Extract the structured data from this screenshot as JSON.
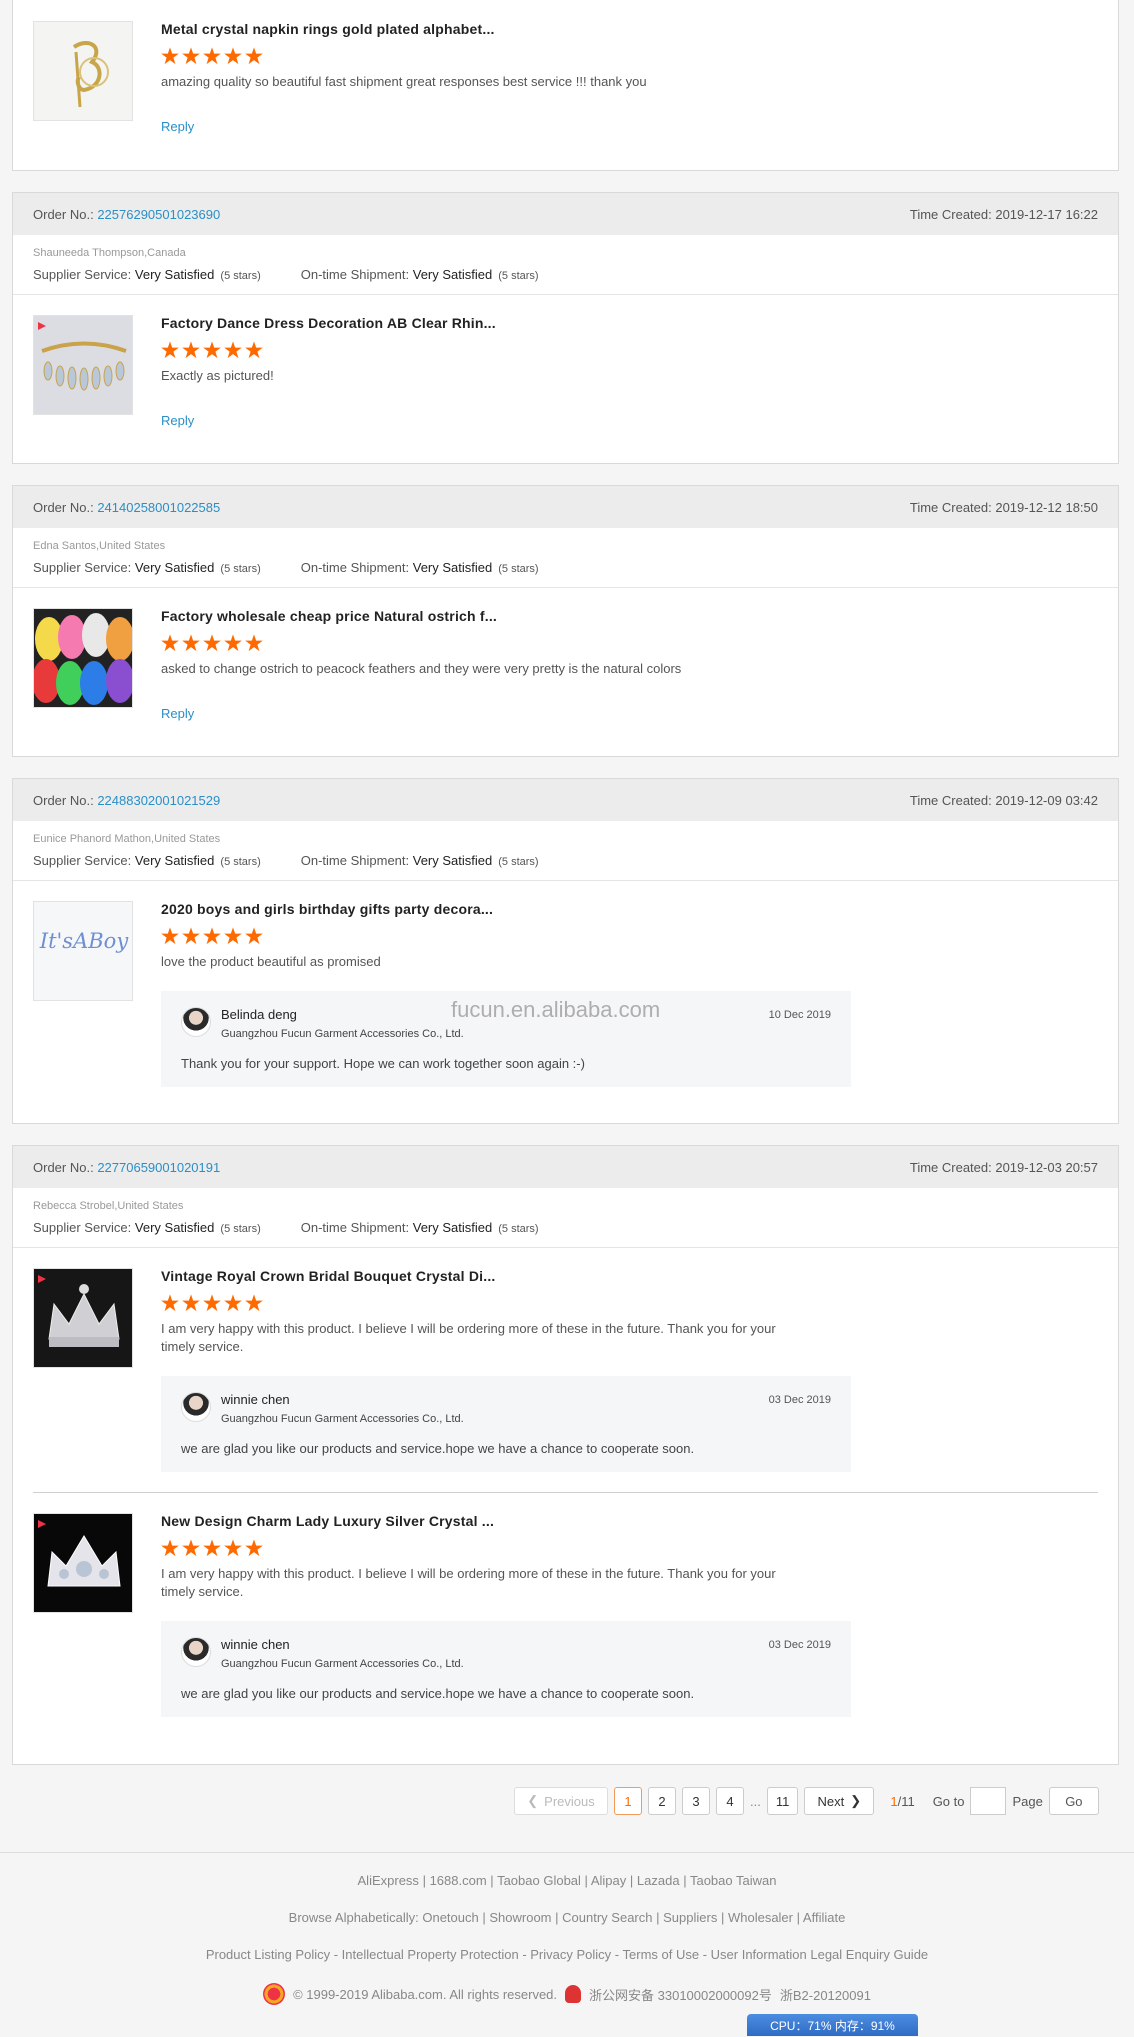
{
  "reviews": [
    {
      "items": [
        {
          "title": "Metal crystal napkin rings gold plated alphabet...",
          "comment": "amazing quality so beautiful fast shipment great responses best service !!! thank you",
          "reply": "Reply"
        }
      ]
    },
    {
      "order_label": "Order No.:",
      "order_no": "22576290501023690",
      "time": "Time Created: 2019-12-17 16:22",
      "buyer": "Shauneeda Thompson,Canada",
      "supplier_label": "Supplier Service:",
      "supplier_value": "Very Satisfied",
      "supplier_stars": "(5 stars)",
      "shipment_label": "On-time Shipment:",
      "shipment_value": "Very Satisfied",
      "shipment_stars": "(5 stars)",
      "items": [
        {
          "title": "Factory Dance Dress Decoration AB Clear Rhin...",
          "comment": "Exactly as pictured!",
          "reply": "Reply"
        }
      ]
    },
    {
      "order_label": "Order No.:",
      "order_no": "24140258001022585",
      "time": "Time Created: 2019-12-12 18:50",
      "buyer": "Edna Santos,United States",
      "supplier_label": "Supplier Service:",
      "supplier_value": "Very Satisfied",
      "supplier_stars": "(5 stars)",
      "shipment_label": "On-time Shipment:",
      "shipment_value": "Very Satisfied",
      "shipment_stars": "(5 stars)",
      "items": [
        {
          "title": "Factory wholesale cheap price Natural ostrich f...",
          "comment": "asked to change ostrich to peacock feathers and they were very pretty is the natural colors",
          "reply": "Reply"
        }
      ]
    },
    {
      "order_label": "Order No.:",
      "order_no": "22488302001021529",
      "time": "Time Created: 2019-12-09 03:42",
      "buyer": "Eunice Phanord Mathon,United States",
      "supplier_label": "Supplier Service:",
      "supplier_value": "Very Satisfied",
      "supplier_stars": "(5 stars)",
      "shipment_label": "On-time Shipment:",
      "shipment_value": "Very Satisfied",
      "shipment_stars": "(5 stars)",
      "items": [
        {
          "title": "2020 boys and girls birthday gifts party decora...",
          "comment": "love the product beautiful as promised",
          "thumb_text": "It'sABoy",
          "seller_reply": {
            "name": "Belinda deng",
            "company": "Guangzhou Fucun Garment Accessories Co., Ltd.",
            "date": "10 Dec 2019",
            "text": "Thank you for your support. Hope we can work together soon again :-)"
          }
        }
      ]
    },
    {
      "order_label": "Order No.:",
      "order_no": "22770659001020191",
      "time": "Time Created: 2019-12-03 20:57",
      "buyer": "Rebecca Strobel,United States",
      "supplier_label": "Supplier Service:",
      "supplier_value": "Very Satisfied",
      "supplier_stars": "(5 stars)",
      "shipment_label": "On-time Shipment:",
      "shipment_value": "Very Satisfied",
      "shipment_stars": "(5 stars)",
      "items": [
        {
          "title": "Vintage Royal Crown Bridal Bouquet Crystal Di...",
          "comment": "I am very happy with this product. I believe I will be ordering more of these in the future. Thank you for your timely service.",
          "seller_reply": {
            "name": "winnie chen",
            "company": "Guangzhou Fucun Garment Accessories Co., Ltd.",
            "date": "03 Dec 2019",
            "text": "we are glad you like our products and service.hope we have a chance to cooperate soon."
          }
        },
        {
          "title": "New Design Charm Lady Luxury Silver Crystal ...",
          "comment": "I am very happy with this product. I believe I will be ordering more of these in the future. Thank you for your timely service.",
          "seller_reply": {
            "name": "winnie chen",
            "company": "Guangzhou Fucun Garment Accessories Co., Ltd.",
            "date": "03 Dec 2019",
            "text": "we are glad you like our products and service.hope we have a chance to cooperate soon."
          }
        }
      ]
    }
  ],
  "watermark": "fucun.en.alibaba.com",
  "pagination": {
    "previous": "Previous",
    "pages": [
      "1",
      "2",
      "3",
      "4"
    ],
    "ellipsis": "...",
    "last": "11",
    "next": "Next",
    "current": "1",
    "total": "/11",
    "goto": "Go to",
    "page": "Page",
    "go": "Go"
  },
  "footer": {
    "line1": [
      "AliExpress",
      "1688.com",
      "Taobao Global",
      "Alipay",
      "Lazada",
      "Taobao Taiwan"
    ],
    "line2_prefix": "Browse Alphabetically:",
    "line2": [
      "Onetouch",
      "Showroom",
      "Country Search",
      "Suppliers",
      "Wholesaler",
      "Affiliate"
    ],
    "line3": [
      "Product Listing Policy",
      "Intellectual Property Protection",
      "Privacy Policy",
      "Terms of Use",
      "User Information Legal Enquiry Guide"
    ],
    "copyright": "© 1999-2019 Alibaba.com. All rights reserved.",
    "icp": "浙公网安备 33010002000092号",
    "icp2": "浙B2-20120091"
  },
  "status_bar": "CPU：71%  内存：91%",
  "colors": {
    "accent": "#ff6a00",
    "link": "#2a8fc7"
  }
}
